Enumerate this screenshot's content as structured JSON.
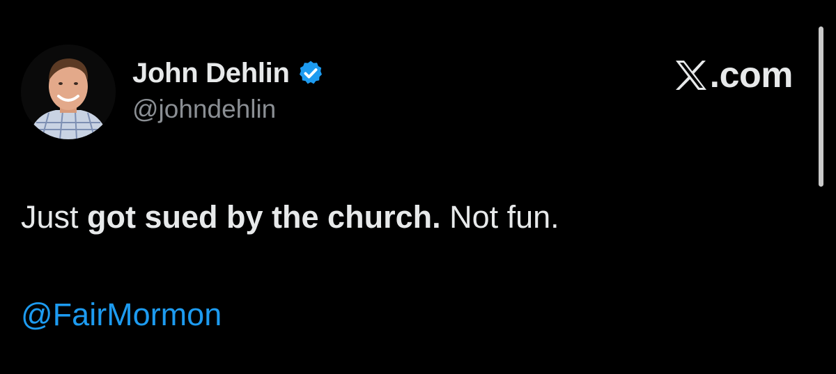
{
  "author": {
    "display_name": "John Dehlin",
    "handle": "@johndehlin",
    "verified": true,
    "avatar_icon": "avatar-photo"
  },
  "brand": {
    "label": ".com",
    "icon": "x-logo-icon"
  },
  "tweet": {
    "text_prefix": "Just ",
    "text_bold": "got sued by the church.",
    "text_suffix": " Not fun.",
    "mention": "@FairMormon"
  },
  "colors": {
    "background": "#000000",
    "text": "#e7e9ea",
    "secondary_text": "#8b8f94",
    "link": "#1d9bf0",
    "verified_badge": "#1d9bf0"
  }
}
